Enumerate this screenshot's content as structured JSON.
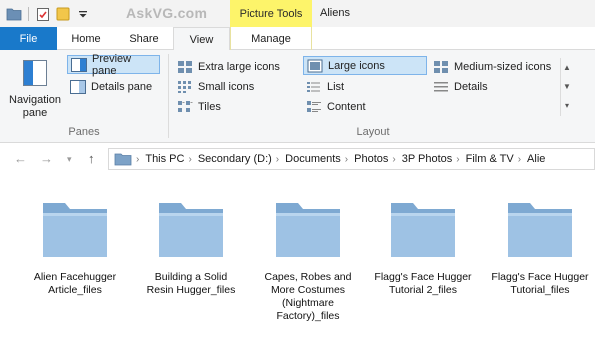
{
  "titlebar": {
    "watermark": "AskVG.com",
    "context_tab_label": "Picture Tools",
    "window_title": "Aliens"
  },
  "tabs": {
    "file": "File",
    "home": "Home",
    "share": "Share",
    "view": "View",
    "manage": "Manage"
  },
  "ribbon": {
    "panes": {
      "navigation_pane": "Navigation pane",
      "preview_pane": "Preview pane",
      "details_pane": "Details pane",
      "group_label": "Panes"
    },
    "layout": {
      "extra_large_icons": "Extra large icons",
      "large_icons": "Large icons",
      "medium_icons": "Medium-sized icons",
      "small_icons": "Small icons",
      "list": "List",
      "details": "Details",
      "tiles": "Tiles",
      "content": "Content",
      "group_label": "Layout",
      "selected": "Large icons"
    }
  },
  "address": {
    "crumbs": [
      "This PC",
      "Secondary (D:)",
      "Documents",
      "Photos",
      "3P Photos",
      "Film & TV",
      "Alie"
    ]
  },
  "folders": [
    {
      "name": "Alien Facehugger Article_files"
    },
    {
      "name": "Building a Solid Resin Hugger_files"
    },
    {
      "name": "Capes, Robes and More Costumes (Nightmare Factory)_files"
    },
    {
      "name": "Flagg's Face Hugger Tutorial 2_files"
    },
    {
      "name": "Flagg's Face Hugger Tutorial_files"
    }
  ],
  "colors": {
    "file_tab": "#1979ca",
    "context_tab": "#fdf46a",
    "selected_button": "#cce4f7",
    "folder": "#8fb8de"
  }
}
